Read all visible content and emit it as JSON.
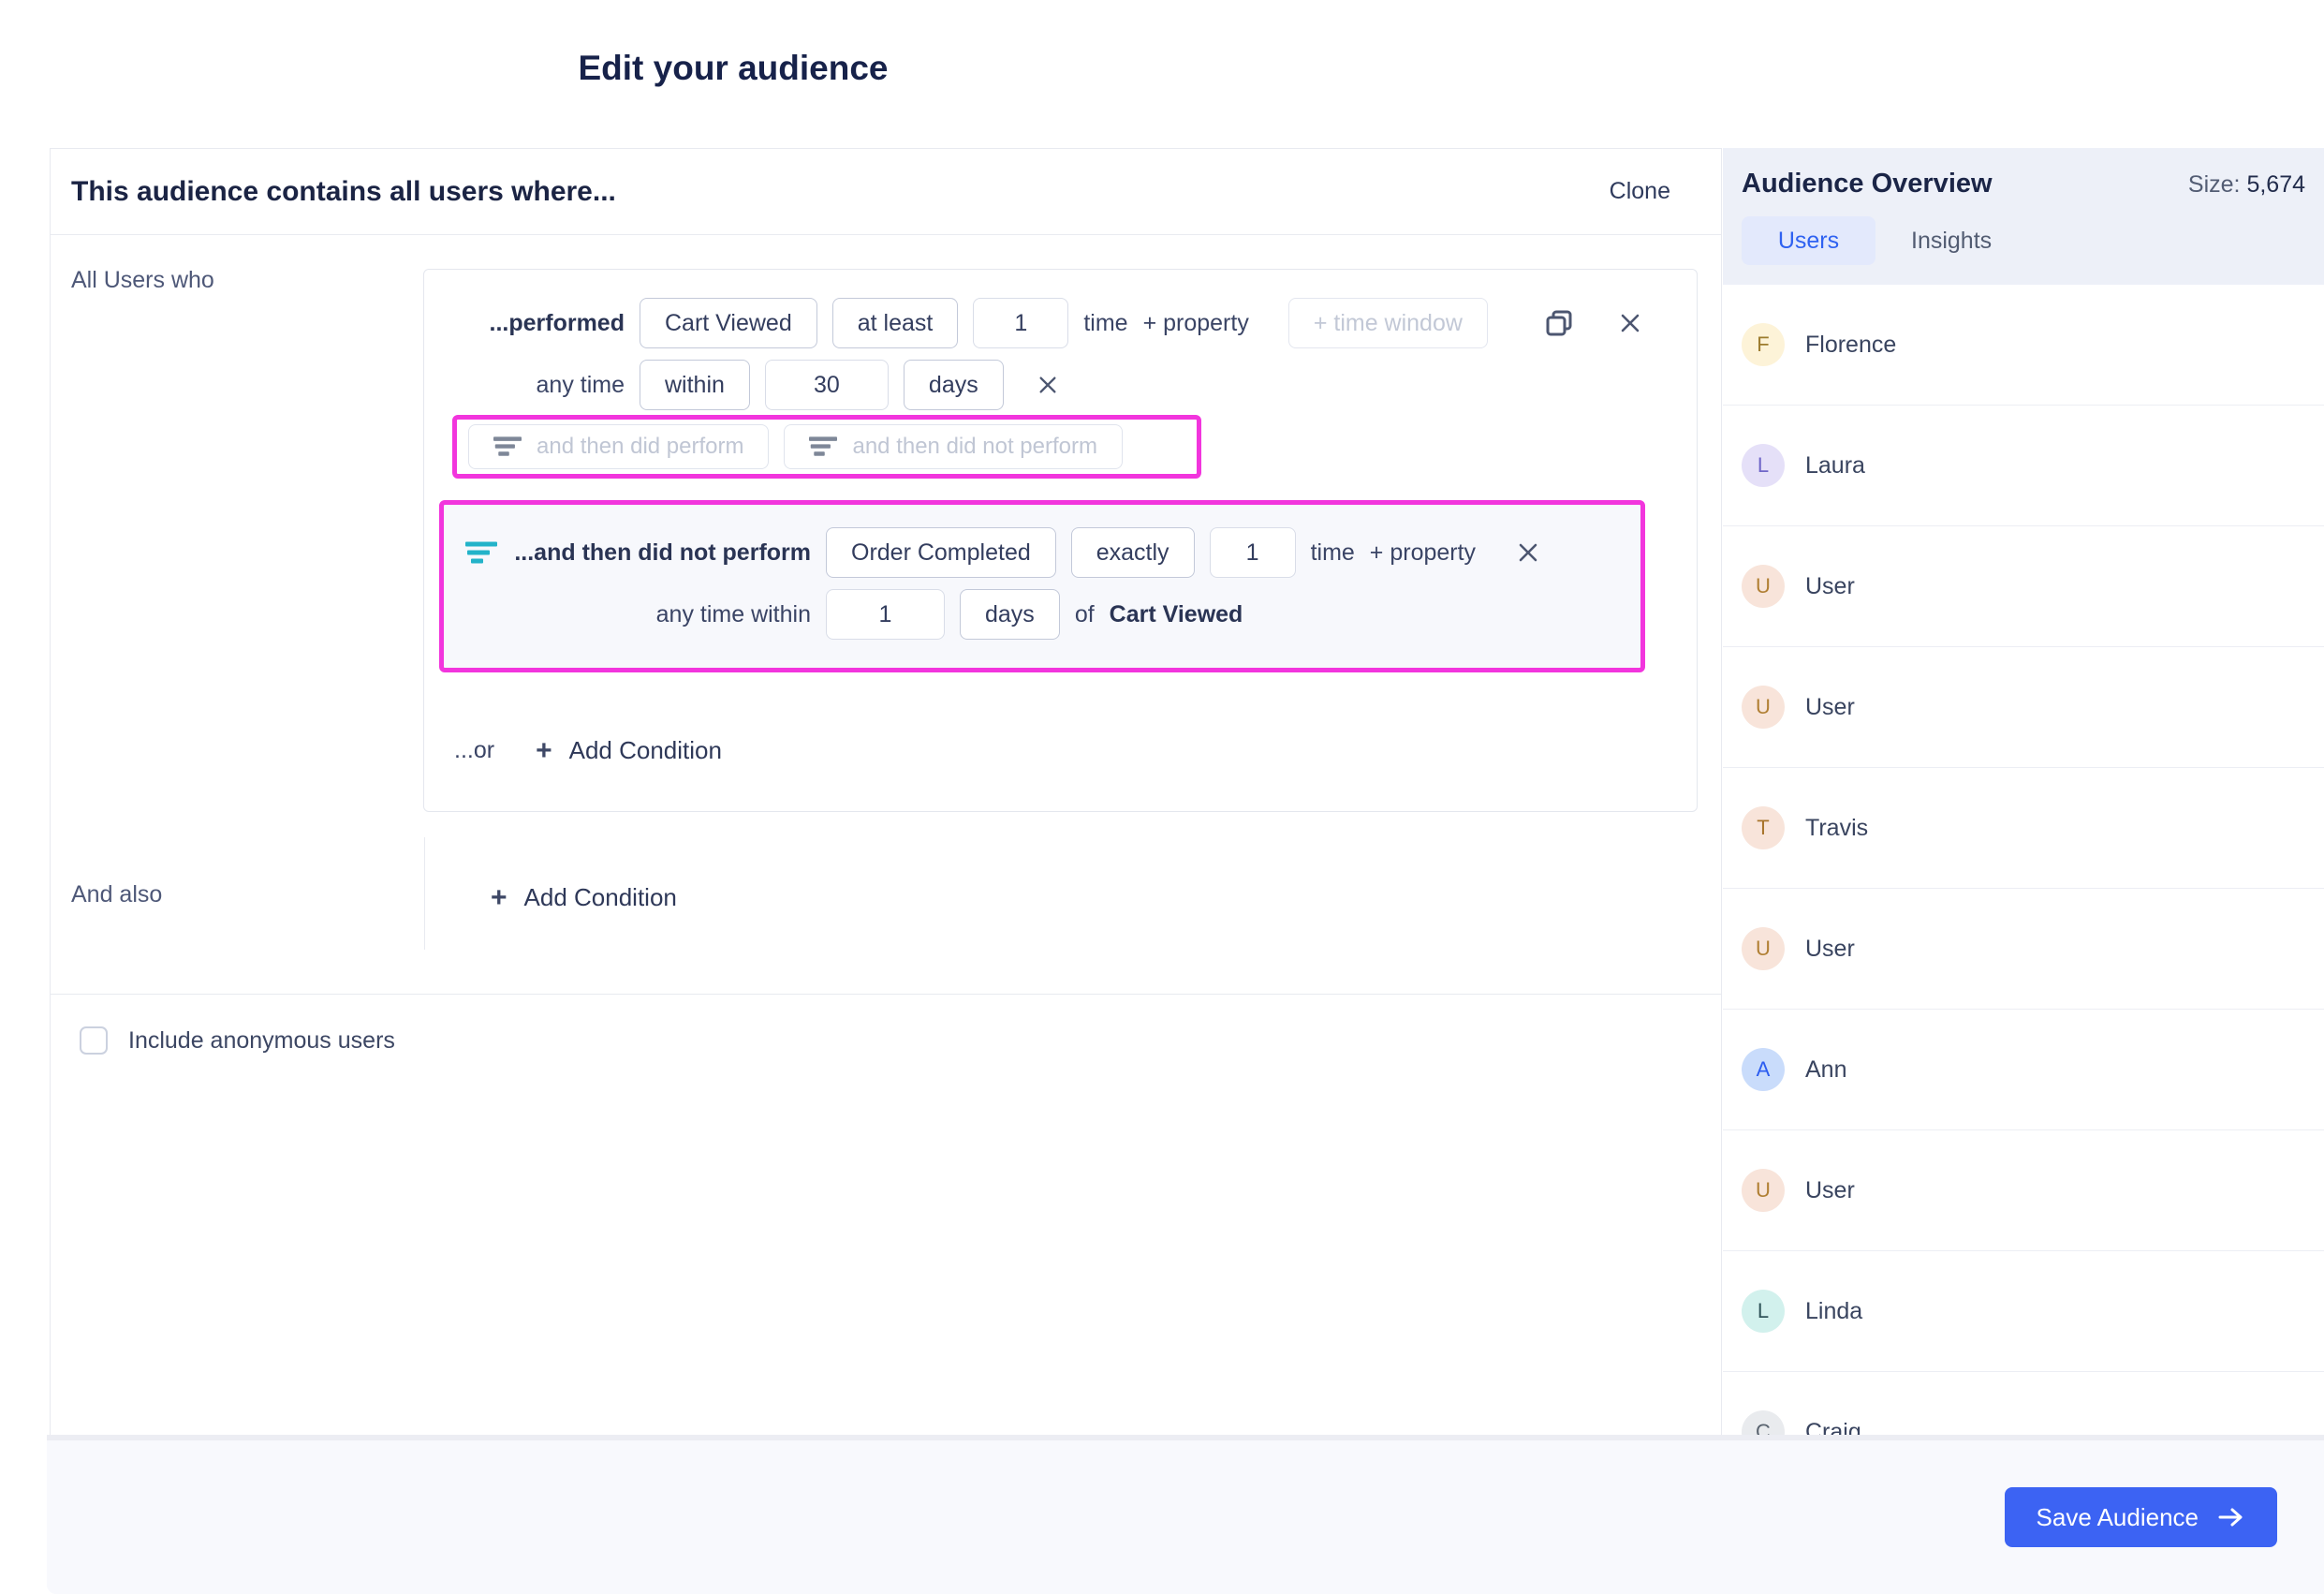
{
  "page_title": "Edit your audience",
  "builder": {
    "header_title": "This audience contains all users where...",
    "clone_label": "Clone",
    "group_label": "All Users who",
    "condition1": {
      "prefix": "...performed",
      "event": "Cart Viewed",
      "operator": "at least",
      "count": "1",
      "time_label": "time",
      "add_property_label": "+ property",
      "time_window_placeholder": "+ time window",
      "any_time_label": "any time",
      "within_operator": "within",
      "within_value": "30",
      "within_unit": "days"
    },
    "sequence_buttons": {
      "did_perform": "and then did perform",
      "did_not_perform": "and then did not perform"
    },
    "condition2": {
      "prefix": "...and then did not perform",
      "event": "Order Completed",
      "operator": "exactly",
      "count": "1",
      "time_label": "time",
      "add_property_label": "+ property",
      "any_time_within_label": "any time within",
      "within_value": "1",
      "within_unit": "days",
      "of_label": "of",
      "reference_event": "Cart Viewed"
    },
    "or_label": "...or",
    "add_condition_label": "Add Condition",
    "and_also_label": "And also",
    "include_anonymous_label": "Include anonymous users"
  },
  "sidebar": {
    "title": "Audience Overview",
    "size_label": "Size:",
    "size_value": "5,674",
    "tabs": {
      "users": "Users",
      "insights": "Insights"
    },
    "users": [
      {
        "initial": "F",
        "name": "Florence",
        "bg": "#fdf3d8",
        "fg": "#9c7b2d"
      },
      {
        "initial": "L",
        "name": "Laura",
        "bg": "#e5e0f8",
        "fg": "#6f66c8"
      },
      {
        "initial": "U",
        "name": "User",
        "bg": "#f8e4da",
        "fg": "#b07f33"
      },
      {
        "initial": "U",
        "name": "User",
        "bg": "#f8e4da",
        "fg": "#b07f33"
      },
      {
        "initial": "T",
        "name": "Travis",
        "bg": "#f8e4da",
        "fg": "#a8742c"
      },
      {
        "initial": "U",
        "name": "User",
        "bg": "#f8e4da",
        "fg": "#b07f33"
      },
      {
        "initial": "A",
        "name": "Ann",
        "bg": "#c9dcfb",
        "fg": "#2b5cf0"
      },
      {
        "initial": "U",
        "name": "User",
        "bg": "#f8e4da",
        "fg": "#b07f33"
      },
      {
        "initial": "L",
        "name": "Linda",
        "bg": "#d2f1ed",
        "fg": "#31555a"
      },
      {
        "initial": "C",
        "name": "Craig",
        "bg": "#e9ebee",
        "fg": "#59636f"
      }
    ]
  },
  "footer": {
    "save_label": "Save Audience"
  },
  "colors": {
    "highlight_magenta": "#f235dd",
    "filter_teal": "#23b3c9",
    "primary_blue": "#3c63f3",
    "tab_blue": "#2f62f1"
  }
}
